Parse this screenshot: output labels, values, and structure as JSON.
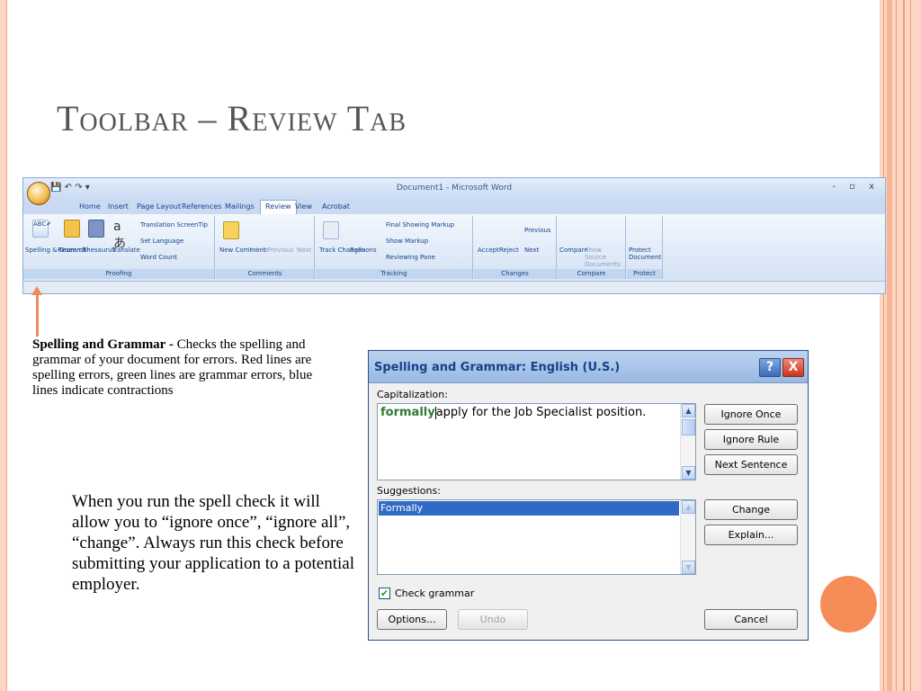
{
  "slide": {
    "title": "Toolbar – Review Tab",
    "description_bold": "Spelling and Grammar - ",
    "description_rest": "Checks the spelling and grammar of your document for errors.  Red lines are spelling errors, green lines are grammar errors, blue lines indicate contractions",
    "note": "When you run the spell check it will allow you to “ignore once”, “ignore all”, “change”.  Always run this check before submitting your application to a potential employer."
  },
  "ribbon": {
    "window_title": "Document1 - Microsoft Word",
    "window_controls": "- ▫ x",
    "tabs": [
      "Home",
      "Insert",
      "Page Layout",
      "References",
      "Mailings",
      "Review",
      "View",
      "Acrobat"
    ],
    "active_tab": "Review",
    "groups": {
      "proofing": {
        "label": "Proofing",
        "items": [
          "Spelling & Grammar",
          "Research",
          "Thesaurus",
          "Translate"
        ],
        "small_items": [
          "Translation ScreenTip",
          "Set Language",
          "Word Count"
        ]
      },
      "comments": {
        "label": "Comments",
        "items": [
          "New Comment",
          "Delete",
          "Previous",
          "Next"
        ]
      },
      "tracking": {
        "label": "Tracking",
        "items": [
          "Track Changes",
          "Balloons"
        ],
        "small_items": [
          "Final Showing Markup",
          "Show Markup",
          "Reviewing Pane"
        ]
      },
      "changes": {
        "label": "Changes",
        "items": [
          "Accept",
          "Reject"
        ],
        "small_items": [
          "Previous",
          "Next"
        ]
      },
      "compare": {
        "label": "Compare",
        "items": [
          "Compare",
          "Show Source Documents"
        ]
      },
      "protect": {
        "label": "Protect",
        "items": [
          "Protect Document"
        ]
      }
    }
  },
  "dialog": {
    "title": "Spelling and Grammar: English (U.S.)",
    "help": "?",
    "close": "X",
    "issue_label": "Capitalization:",
    "error_word": "formally",
    "sentence_rest": "apply for the Job Specialist position.",
    "suggestions_label": "Suggestions:",
    "suggestions": [
      "Formally"
    ],
    "buttons": {
      "ignore_once": "Ignore Once",
      "ignore_rule": "Ignore Rule",
      "next_sentence": "Next Sentence",
      "change": "Change",
      "explain": "Explain...",
      "options": "Options...",
      "undo": "Undo",
      "cancel": "Cancel"
    },
    "check_grammar_label": "Check grammar",
    "check_grammar_checked": true
  },
  "colors": {
    "accent": "#f68d58",
    "frame": "#fbd6c4",
    "ribbon_blue": "#dbe7f6",
    "selection": "#316ac5"
  }
}
